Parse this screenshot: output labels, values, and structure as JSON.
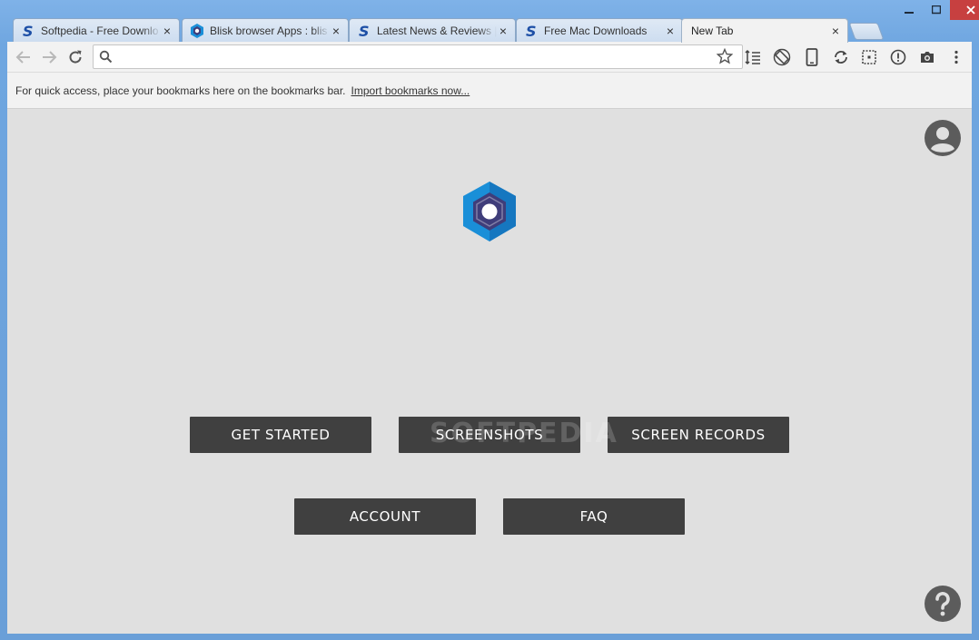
{
  "window": {
    "controls": [
      "minimize-icon",
      "maximize-icon",
      "close-icon"
    ]
  },
  "tabs": [
    {
      "title": "Softpedia - Free Downlo",
      "favicon": "softpedia-s-icon",
      "active": false
    },
    {
      "title": "Blisk browser Apps : blis",
      "favicon": "blisk-icon",
      "active": false
    },
    {
      "title": "Latest News & Reviews |",
      "favicon": "softpedia-s-icon",
      "active": false
    },
    {
      "title": "Free Mac Downloads",
      "favicon": "softpedia-s-icon",
      "active": false
    },
    {
      "title": "New Tab",
      "favicon": "",
      "active": true
    }
  ],
  "toolbar": {
    "address_value": "",
    "icons": [
      "back-icon",
      "forward-icon",
      "reload-icon",
      "search-icon",
      "star-icon",
      "devices-list-icon",
      "rotate-icon",
      "phone-icon",
      "sync-icon",
      "layout-grid-icon",
      "analytics-alert-icon",
      "camera-icon",
      "more-vert-icon"
    ]
  },
  "bookmarks_bar": {
    "message": "For quick access, place your bookmarks here on the bookmarks bar.",
    "import_link": "Import bookmarks now..."
  },
  "content": {
    "buttons_row1": [
      "GET STARTED",
      "SCREENSHOTS",
      "SCREEN RECORDS"
    ],
    "buttons_row2": [
      "ACCOUNT",
      "FAQ"
    ],
    "watermark": "SOFTPEDIA",
    "colors": {
      "background": "#e0e0e0",
      "button_bg": "#404040",
      "logo_blue": "#1a8fd8",
      "logo_purple": "#3f3d7a"
    }
  }
}
